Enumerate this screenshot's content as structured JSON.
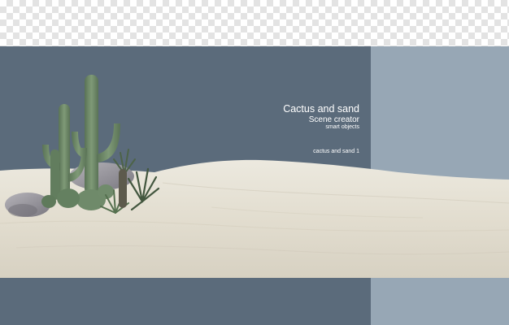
{
  "caption": {
    "title": "Cactus and sand",
    "subtitle": "Scene creator",
    "note": "smart objects"
  },
  "label": "cactus and sand 1",
  "colors": {
    "panel_dark": "#5b6b7b",
    "panel_light": "#97a7b5",
    "sand": "#e8e4d8",
    "cactus": "#6f8a6a",
    "checker": "#e3e3e3"
  },
  "icons": {
    "background": "transparency-checkerboard",
    "scene": "desert-cactus-illustration"
  }
}
